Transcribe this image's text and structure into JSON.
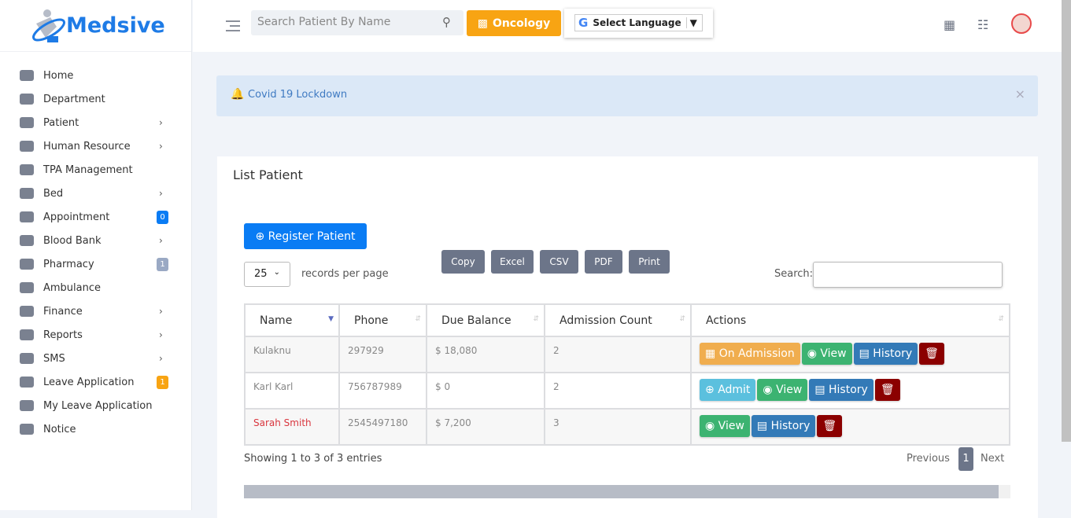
{
  "brand": {
    "name": "Medsive"
  },
  "sidebar": {
    "items": [
      {
        "label": "Home"
      },
      {
        "label": "Department"
      },
      {
        "label": "Patient",
        "chevron": true
      },
      {
        "label": "Human Resource",
        "chevron": true
      },
      {
        "label": "TPA Management"
      },
      {
        "label": "Bed",
        "chevron": true
      },
      {
        "label": "Appointment",
        "badge": "0",
        "badge_color": "#0a7cf4"
      },
      {
        "label": "Blood Bank",
        "chevron": true
      },
      {
        "label": "Pharmacy",
        "badge": "1",
        "badge_color": "#9aa9c4"
      },
      {
        "label": "Ambulance"
      },
      {
        "label": "Finance",
        "chevron": true
      },
      {
        "label": "Reports",
        "chevron": true
      },
      {
        "label": "SMS",
        "chevron": true
      },
      {
        "label": "Leave Application",
        "badge": "1",
        "badge_color": "#f8a413"
      },
      {
        "label": "My Leave Application"
      },
      {
        "label": "Notice"
      }
    ]
  },
  "topbar": {
    "search_placeholder": "Search Patient By Name",
    "department": "Oncology",
    "language": "Select Language",
    "google": "G"
  },
  "alert": {
    "text": "Covid 19 Lockdown",
    "close": "×"
  },
  "card": {
    "title": "List Patient",
    "register_label": "Register Patient",
    "page_size": "25",
    "records_label": "records per page",
    "export": [
      "Copy",
      "Excel",
      "CSV",
      "PDF",
      "Print"
    ],
    "search_label": "Search:",
    "columns": [
      "Name",
      "Phone",
      "Due Balance",
      "Admission Count",
      "Actions"
    ],
    "rows": [
      {
        "name": "Kulaknu",
        "phone": "297929",
        "due": "$ 18,080",
        "count": "2",
        "actions": [
          "On Admission",
          "View",
          "History",
          "delete"
        ]
      },
      {
        "name": "Karl Karl",
        "phone": "756787989",
        "due": "$ 0",
        "count": "2",
        "actions": [
          "Admit",
          "View",
          "History",
          "delete"
        ]
      },
      {
        "name": "Sarah Smith",
        "phone": "2545497180",
        "due": "$ 7,200",
        "count": "3",
        "actions": [
          "View",
          "History",
          "delete"
        ],
        "highlight": "#d9363e"
      }
    ],
    "info": "Showing 1 to 3 of 3 entries",
    "previous": "Previous",
    "page": "1",
    "next": "Next"
  },
  "colors": {
    "On Admission": "#f0ad4e",
    "Admit": "#5bc0de",
    "View": "#3cb371",
    "History": "#337ab7",
    "delete": "#8b0000"
  }
}
